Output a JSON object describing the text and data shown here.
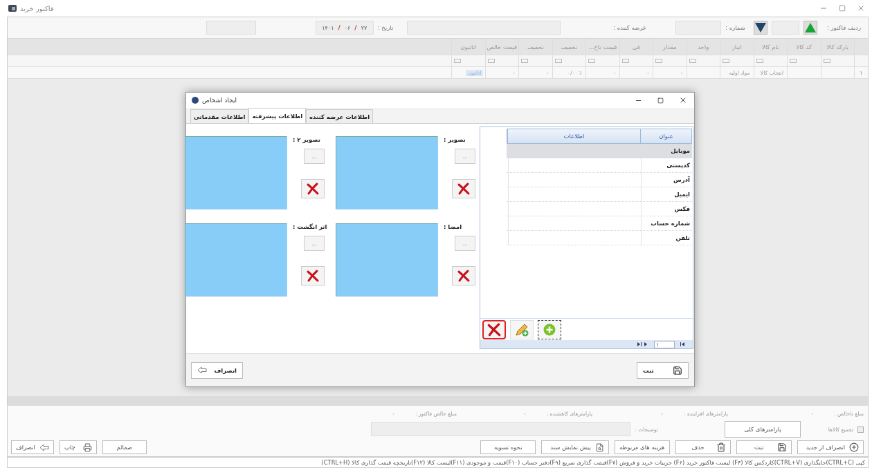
{
  "window": {
    "title": "فاکتور خرید"
  },
  "header": {
    "invoice_row_label": "ردیف فاکتور :",
    "number_label": "شماره :",
    "supplier_label": "عرضه کننده :",
    "date_label": "تاریخ :",
    "date_parts": [
      "۲۷",
      "۰۶",
      "۱۴۰۱"
    ],
    "date_separator": "/"
  },
  "grid": {
    "columns": [
      "بارکد کالا",
      "کد کالا",
      "نام کالا",
      "انبار",
      "واحد",
      "مقدار",
      "فی",
      "قیمت ناخ...",
      "تخفیف",
      "تخفیف",
      "قیمت خالص",
      "اتاثیون"
    ],
    "rows": [
      {
        "index": "۱",
        "cells": [
          {},
          {},
          {
            "text": "انتخاب کالا"
          },
          {
            "text": "مواد اولیه"
          },
          {},
          {
            "text": "-"
          },
          {
            "text": "-"
          },
          {
            "text": "-"
          },
          {
            "text": "٪ ۰/۰۰"
          },
          {
            "text": "-"
          },
          {
            "text": "-"
          },
          {
            "text": "اتاثیون",
            "highlighted": true
          }
        ]
      }
    ]
  },
  "dialog": {
    "title": "ایجاد اشخاص",
    "tabs": [
      {
        "label": "اطلاعات عرضه کننده",
        "selected": false
      },
      {
        "label": "اطلاعات پیشرفته",
        "selected": true
      },
      {
        "label": "اطلاعات مقدماتی",
        "selected": false
      }
    ],
    "image_slots": [
      {
        "label": "تصویر :",
        "browse": "..."
      },
      {
        "label": "تصویر ۲ :",
        "browse": "..."
      },
      {
        "label": "امضا :",
        "browse": "..."
      },
      {
        "label": "اثر انگشت :",
        "browse": "..."
      }
    ],
    "contacts": {
      "columns": [
        "عنوان",
        "اطلاعات"
      ],
      "rows": [
        {
          "title": "موبایل",
          "selected": true
        },
        {
          "title": "کدپستی",
          "selected": false
        },
        {
          "title": "آدرس",
          "selected": false
        },
        {
          "title": "ایمیل",
          "selected": false
        },
        {
          "title": "فکس",
          "selected": false
        },
        {
          "title": "شماره حساب",
          "selected": false
        },
        {
          "title": "تلفن",
          "selected": false
        }
      ],
      "pager_page": "۱"
    },
    "save": "ثبت",
    "cancel": "انصراف"
  },
  "footer": {
    "totals": [
      {
        "label": "مبلغ ناخالص :",
        "value": "-"
      },
      {
        "label": "پارامترهای افزاینده :",
        "value": "-"
      },
      {
        "label": "پارامترهای کاهشنده :",
        "value": "-"
      },
      {
        "label": "مبلغ خالص فاکتور :",
        "value": "-"
      }
    ],
    "merge": {
      "label": "تجمیع کالاها",
      "checked": false
    },
    "params_button": "پارامترهای کلی",
    "notes_label": "توضیحات :",
    "actions": [
      {
        "label": "انصراف از جدید",
        "kind": "plus"
      },
      {
        "label": "ثبت",
        "kind": "save"
      },
      {
        "label": "حذف",
        "kind": "trash"
      },
      {
        "label": "هزینه های مربوطه",
        "kind": "plain"
      },
      {
        "label": "پیش نمایش سند",
        "kind": "preview"
      },
      {
        "label": "نحوه تسویه",
        "kind": "plain"
      }
    ],
    "secondary_actions": [
      {
        "label": "ضمائم",
        "kind": "plain"
      },
      {
        "label": "چاپ",
        "kind": "print"
      },
      {
        "label": "انصراف",
        "kind": "back"
      }
    ]
  },
  "status_bar": "کپی (CTRL+C)جایگذاری (CTRL+V)کاردکس کالا (F۳) لیست فاکتور خرید (F۶) جزییات خرید و فروش (F۷)قیمت گذاری سریع (F۹)دفتر حساب (F۱۰)قیمت و موجودی (F۱۱)لیست کالا (F۱۲)تاریخچه قیمت گذاری کالا (CTRL+H)"
}
